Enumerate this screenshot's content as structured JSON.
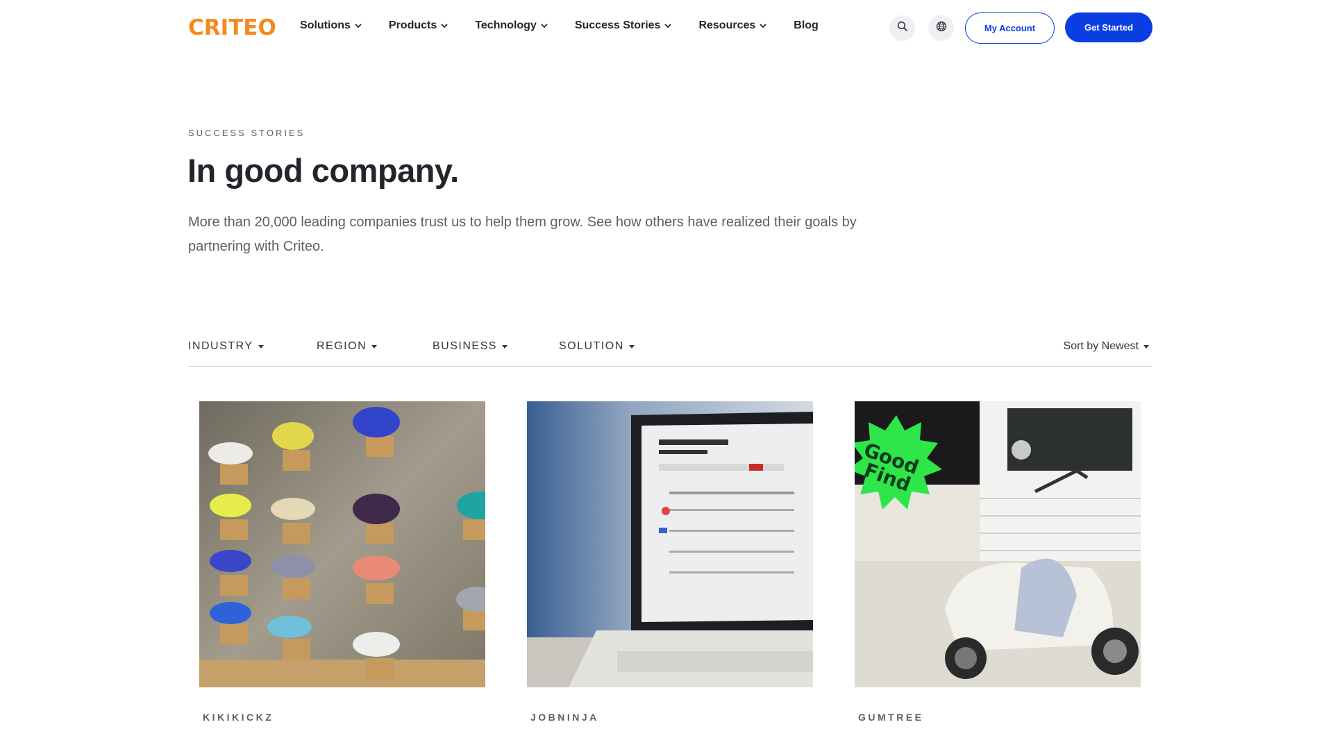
{
  "header": {
    "logo_text": "CRITEO",
    "nav": [
      {
        "label": "Solutions",
        "has_dropdown": true
      },
      {
        "label": "Products",
        "has_dropdown": true
      },
      {
        "label": "Technology",
        "has_dropdown": true
      },
      {
        "label": "Success Stories",
        "has_dropdown": true
      },
      {
        "label": "Resources",
        "has_dropdown": true
      },
      {
        "label": "Blog",
        "has_dropdown": false
      }
    ],
    "search_icon": "search-icon",
    "language_icon": "globe-icon",
    "my_account_label": "My Account",
    "get_started_label": "Get Started"
  },
  "hero": {
    "eyebrow": "SUCCESS STORIES",
    "title": "In good company.",
    "description": "More than 20,000 leading companies trust us to help them grow. See how others have realized their goals by partnering with Criteo."
  },
  "filters": {
    "items": [
      {
        "label": "INDUSTRY"
      },
      {
        "label": "REGION"
      },
      {
        "label": "BUSINESS"
      },
      {
        "label": "SOLUTION"
      }
    ],
    "sort_label": "Sort by Newest"
  },
  "cards": [
    {
      "label": "KIKIKICKZ",
      "image": "sneaker-wall-photo"
    },
    {
      "label": "JOBNINJA",
      "image": "laptop-job-site-photo"
    },
    {
      "label": "GUMTREE",
      "image": "scooter-good-find-photo",
      "sticker_text": "Good Find"
    }
  ],
  "colors": {
    "brand_orange": "#f48a1c",
    "primary_blue": "#0a3ee3",
    "text_dark": "#22252b",
    "text_muted": "#5b5f66",
    "sticker_green": "#2ee64a"
  }
}
